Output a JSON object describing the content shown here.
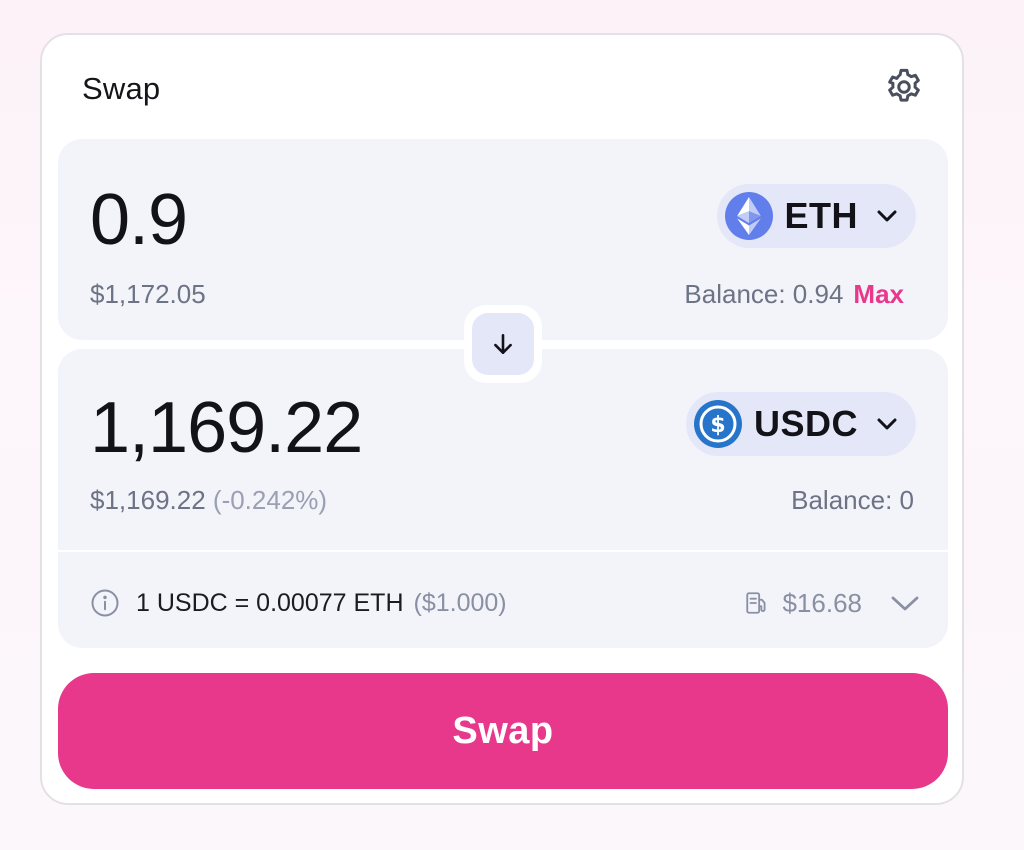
{
  "header": {
    "title": "Swap",
    "settings_icon": "gear-icon"
  },
  "sell": {
    "amount": "0.9",
    "usd_value": "$1,172.05",
    "token": {
      "symbol": "ETH",
      "icon": "eth-icon",
      "color": "#627eea"
    },
    "balance": "Balance: 0.94",
    "max_label": "Max"
  },
  "buy": {
    "amount": "1,169.22",
    "usd_value": "$1,169.22",
    "price_impact": "(-0.242%)",
    "token": {
      "symbol": "USDC",
      "icon": "usdc-icon",
      "color": "#2775ca"
    },
    "balance": "Balance: 0"
  },
  "rate": {
    "text": "1 USDC = 0.00077 ETH",
    "usd": "($1.000)",
    "gas_fee": "$16.68",
    "info_icon": "info-icon",
    "gas_icon": "gas-pump-icon"
  },
  "action": {
    "swap_label": "Swap",
    "color": "#e7388c"
  }
}
